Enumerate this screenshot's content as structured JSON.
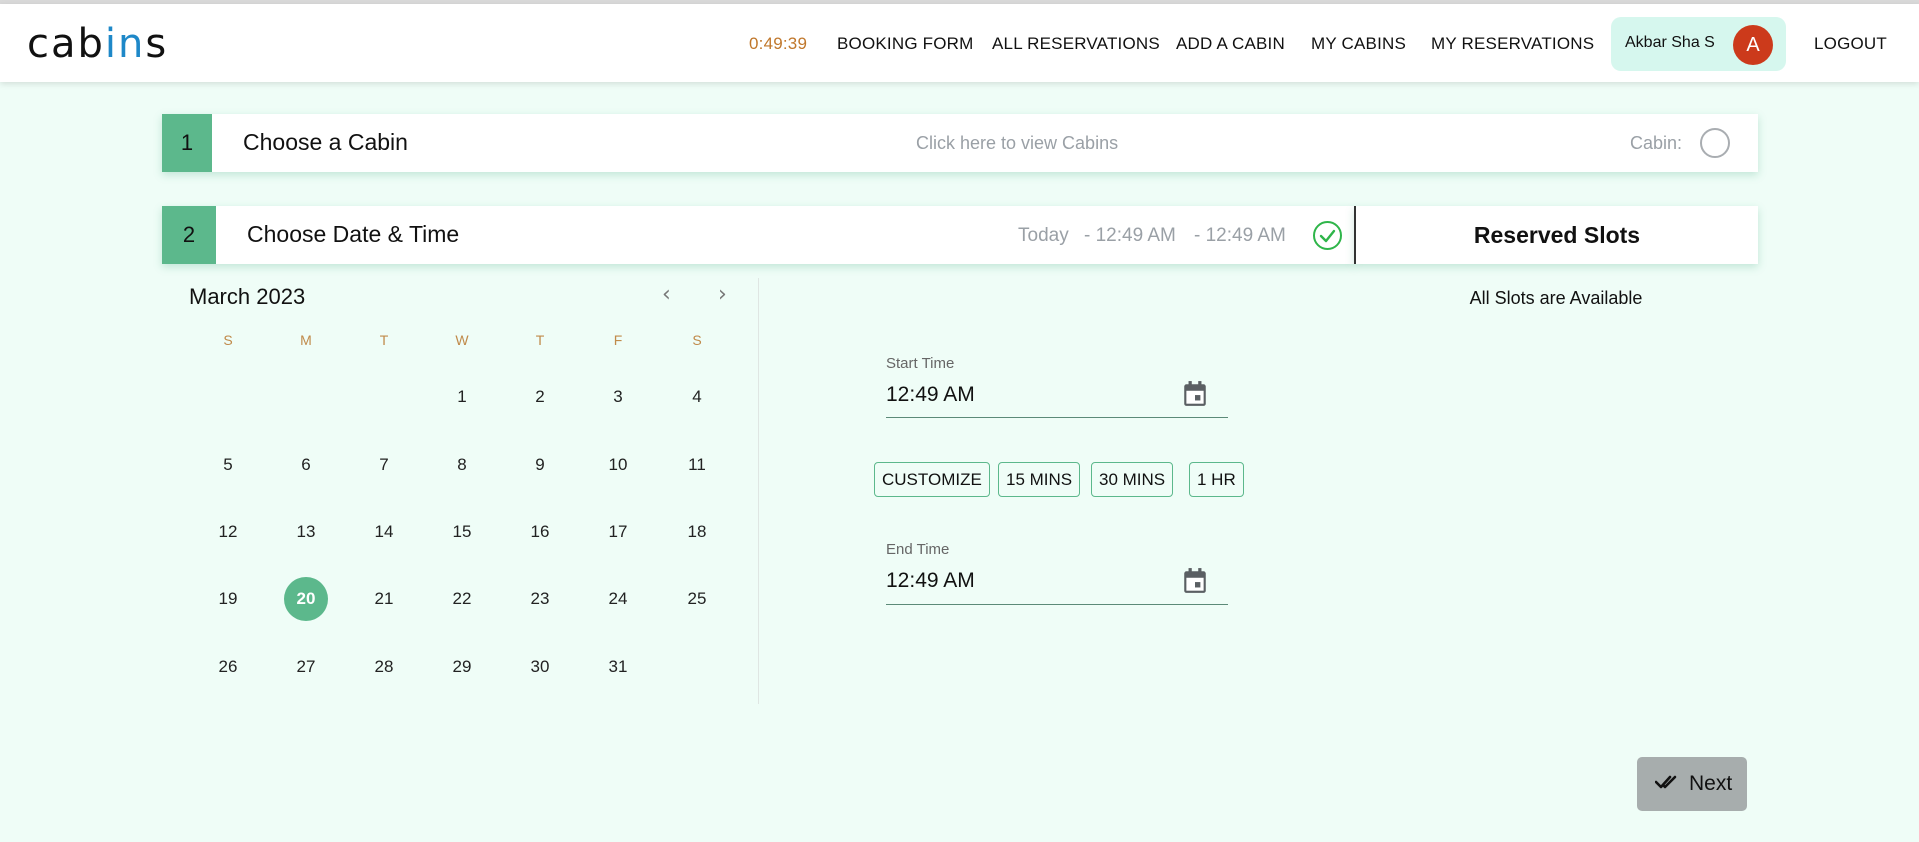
{
  "header": {
    "logo_prefix": "cab",
    "logo_accent": "in",
    "logo_suffix": "s",
    "timer": "0:49:39",
    "nav": [
      "BOOKING FORM",
      "ALL RESERVATIONS",
      "ADD A CABIN",
      "MY CABINS",
      "MY RESERVATIONS"
    ],
    "user_name": "Akbar Sha S",
    "avatar_letter": "A",
    "logout": "LOGOUT"
  },
  "step1": {
    "number": "1",
    "title": "Choose a Cabin",
    "hint": "Click here  to view Cabins",
    "cabin_label": "Cabin:"
  },
  "step2": {
    "number": "2",
    "title": "Choose Date & Time",
    "summary_day": "Today",
    "summary_start": "- 12:49 AM",
    "summary_end": "- 12:49 AM"
  },
  "calendar": {
    "month": "March 2023",
    "weekdays": [
      "S",
      "M",
      "T",
      "W",
      "T",
      "F",
      "S"
    ],
    "selected": "20",
    "weeks": [
      [
        "",
        "",
        "",
        "1",
        "2",
        "3",
        "4"
      ],
      [
        "5",
        "6",
        "7",
        "8",
        "9",
        "10",
        "11"
      ],
      [
        "12",
        "13",
        "14",
        "15",
        "16",
        "17",
        "18"
      ],
      [
        "19",
        "20",
        "21",
        "22",
        "23",
        "24",
        "25"
      ],
      [
        "26",
        "27",
        "28",
        "29",
        "30",
        "31",
        ""
      ]
    ]
  },
  "time": {
    "start_label": "Start Time",
    "start_value": "12:49 AM",
    "end_label": "End Time",
    "end_value": "12:49 AM",
    "durations": [
      "CUSTOMIZE",
      "15 MINS",
      "30 MINS",
      "1 HR"
    ]
  },
  "reserved": {
    "title": "Reserved Slots",
    "status": "All Slots are Available"
  },
  "footer": {
    "next_label": "Next"
  },
  "colors": {
    "accent": "#5cb88c",
    "timer": "#c0772b",
    "avatar": "#cc3a1b",
    "background": "#effdf7"
  }
}
